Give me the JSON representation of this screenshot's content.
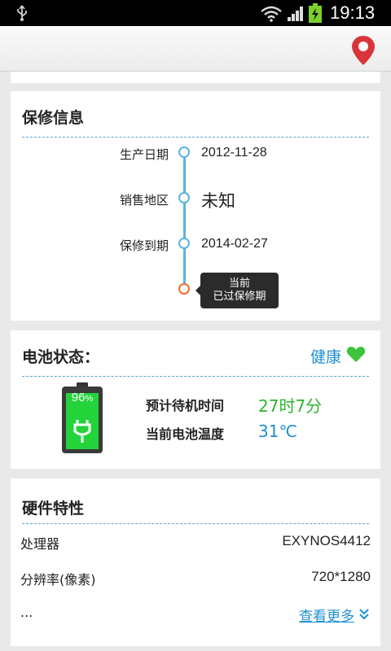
{
  "status_bar": {
    "time": "19:13",
    "icons": [
      "usb-icon",
      "wifi-icon",
      "signal-icon",
      "battery-charging-icon"
    ]
  },
  "action_bar": {
    "icon": "location-pin-icon",
    "accent": "#d9343a"
  },
  "warranty": {
    "title": "保修信息",
    "rows": [
      {
        "label": "生产日期",
        "value": "2012-11-28"
      },
      {
        "label": "销售地区",
        "value": "未知"
      },
      {
        "label": "保修到期",
        "value": "2014-02-27"
      }
    ],
    "tooltip_line1": "当前",
    "tooltip_line2": "已过保修期"
  },
  "battery": {
    "title": "电池状态：",
    "health": "健康",
    "health_icon": "heart-icon",
    "percent": "96",
    "percent_unit": "%",
    "level": 0.96,
    "rows": [
      {
        "label": "预计待机时间",
        "value": "27时7分",
        "color": "#2bb52b"
      },
      {
        "label": "当前电池温度",
        "value": "31℃",
        "color": "#1e8fd2"
      }
    ]
  },
  "hardware": {
    "title": "硬件特性",
    "rows": [
      {
        "label": "处理器",
        "value": "EXYNOS4412"
      },
      {
        "label": "分辨率(像素)",
        "value": "720*1280"
      }
    ],
    "ellipsis": "...",
    "more_label": "查看更多"
  },
  "colors": {
    "blue": "#1e8fd2",
    "green": "#2bb52b",
    "orange": "#f06b2d"
  }
}
